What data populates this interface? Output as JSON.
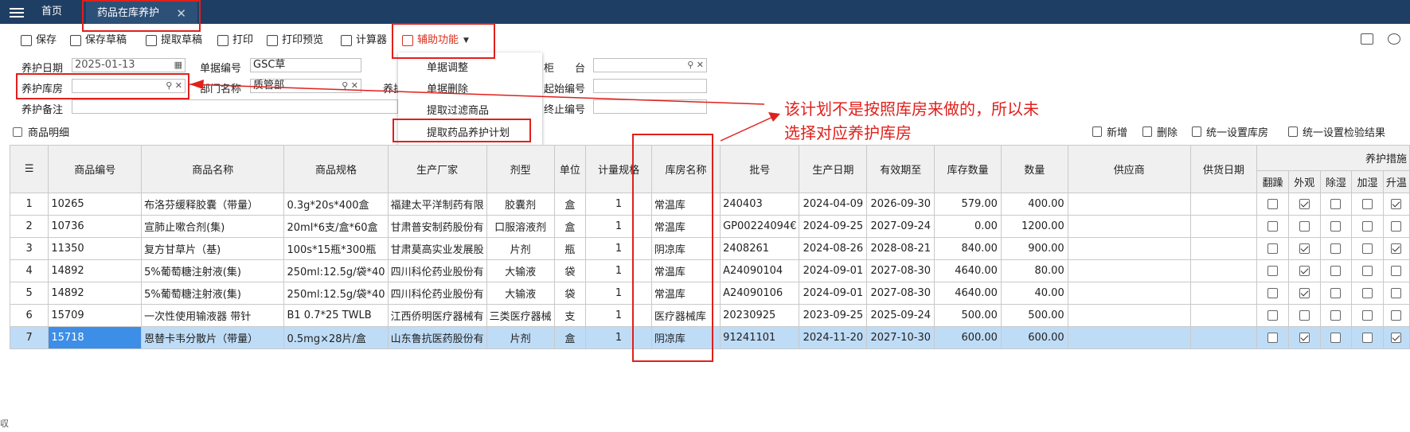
{
  "tabs": {
    "home": "首页",
    "active": "药品在库养护",
    "close": "✕"
  },
  "toolbar": {
    "save": "保存",
    "save_draft": "保存草稿",
    "fetch_draft": "提取草稿",
    "print": "打印",
    "print_preview": "打印预览",
    "calculator": "计算器",
    "aux": "辅助功能"
  },
  "form": {
    "date_label": "养护日期",
    "date_value": "2025-01-13",
    "doc_no_label": "单据编号",
    "doc_no_value": "GSC草",
    "cabinet_label": "柜　　台",
    "warehouse_label": "养护库房",
    "dept_label": "部门名称",
    "dept_value": "质管部",
    "person_label": "养护",
    "start_no_label": "起始编号",
    "note_label": "养护备注",
    "end_no_label": "终止编号"
  },
  "menu": {
    "items": [
      "单据调整",
      "单据删除",
      "提取过滤商品",
      "提取药品养护计划"
    ]
  },
  "annotation": {
    "line1": "该计划不是按照库房来做的，所以未",
    "line2": "选择对应养护库房"
  },
  "section": {
    "title": "商品明细"
  },
  "actions": {
    "add": "新增",
    "delete": "删除",
    "set_warehouse": "统一设置库房",
    "set_check": "统一设置检验结果"
  },
  "table": {
    "headers": {
      "code": "商品编号",
      "name": "商品名称",
      "spec": "商品规格",
      "maker": "生产厂家",
      "form": "剂型",
      "unit": "单位",
      "meas": "计量规格",
      "wh": "库房名称",
      "batch": "批号",
      "mfg": "生产日期",
      "exp": "有效期至",
      "stock": "库存数量",
      "qty": "数量",
      "supplier": "供应商",
      "supply_date": "供货日期",
      "measures": "养护措施",
      "m1": "翻躁",
      "m2": "外观",
      "m3": "除湿",
      "m4": "加湿",
      "m5": "升温"
    },
    "rows": [
      {
        "no": "1",
        "code": "10265",
        "name": "布洛芬缓释胶囊（带量）",
        "spec": "0.3g*20s*400盒",
        "maker": "福建太平洋制药有限",
        "form": "胶囊剂",
        "unit": "盒",
        "meas": "1",
        "wh": "常温库",
        "batch": "240403",
        "mfg": "2024-04-09",
        "exp": "2026-09-30",
        "stock": "579.00",
        "qty": "400.00",
        "checks": [
          false,
          true,
          false,
          false,
          true
        ]
      },
      {
        "no": "2",
        "code": "10736",
        "name": "宣肺止嗽合剂(集)",
        "spec": "20ml*6支/盒*60盒",
        "maker": "甘肃普安制药股份有",
        "form": "口服溶液剂",
        "unit": "盒",
        "meas": "1",
        "wh": "常温库",
        "batch": "GP00224094€",
        "mfg": "2024-09-25",
        "exp": "2027-09-24",
        "stock": "0.00",
        "qty": "1200.00",
        "checks": [
          false,
          false,
          false,
          false,
          false
        ]
      },
      {
        "no": "3",
        "code": "11350",
        "name": "复方甘草片（基)",
        "spec": "100s*15瓶*300瓶",
        "maker": "甘肃莫高实业发展股",
        "form": "片剂",
        "unit": "瓶",
        "meas": "1",
        "wh": "阴凉库",
        "batch": "2408261",
        "mfg": "2024-08-26",
        "exp": "2028-08-21",
        "stock": "840.00",
        "qty": "900.00",
        "checks": [
          false,
          true,
          false,
          false,
          true
        ]
      },
      {
        "no": "4",
        "code": "14892",
        "name": "5%葡萄糖注射液(集)",
        "spec": "250ml:12.5g/袋*40",
        "maker": "四川科伦药业股份有",
        "form": "大输液",
        "unit": "袋",
        "meas": "1",
        "wh": "常温库",
        "batch": "A24090104",
        "mfg": "2024-09-01",
        "exp": "2027-08-30",
        "stock": "4640.00",
        "qty": "80.00",
        "checks": [
          false,
          true,
          false,
          false,
          false
        ]
      },
      {
        "no": "5",
        "code": "14892",
        "name": "5%葡萄糖注射液(集)",
        "spec": "250ml:12.5g/袋*40",
        "maker": "四川科伦药业股份有",
        "form": "大输液",
        "unit": "袋",
        "meas": "1",
        "wh": "常温库",
        "batch": "A24090106",
        "mfg": "2024-09-01",
        "exp": "2027-08-30",
        "stock": "4640.00",
        "qty": "40.00",
        "checks": [
          false,
          true,
          false,
          false,
          false
        ]
      },
      {
        "no": "6",
        "code": "15709",
        "name": "一次性使用输液器 带针",
        "spec": "B1 0.7*25 TWLB",
        "maker": "江西侨明医疗器械有",
        "form": "三类医疗器械",
        "unit": "支",
        "meas": "1",
        "wh": "医疗器械库",
        "batch": "20230925",
        "mfg": "2023-09-25",
        "exp": "2025-09-24",
        "stock": "500.00",
        "qty": "500.00",
        "checks": [
          false,
          false,
          false,
          false,
          false
        ]
      },
      {
        "no": "7",
        "code": "15718",
        "name": "恩替卡韦分散片（带量）",
        "spec": "0.5mg×28片/盒",
        "maker": "山东鲁抗医药股份有",
        "form": "片剂",
        "unit": "盒",
        "meas": "1",
        "wh": "阴凉库",
        "batch": "91241101",
        "mfg": "2024-11-20",
        "exp": "2027-10-30",
        "stock": "600.00",
        "qty": "600.00",
        "checks": [
          false,
          true,
          false,
          false,
          true
        ]
      }
    ]
  },
  "colors": {
    "topbar": "#1f3e63",
    "highlight": "#e0201c",
    "selected_row": "#bfdcf7"
  },
  "side_text": "収"
}
